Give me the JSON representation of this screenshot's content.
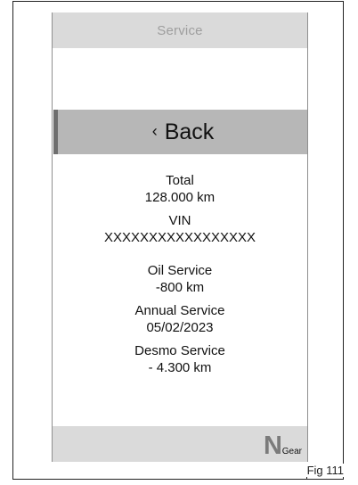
{
  "screen": {
    "header": {
      "title": "Service"
    },
    "back": {
      "icon": "chevron-left-icon",
      "label": "Back"
    },
    "sections": {
      "total": {
        "label": "Total",
        "value": "128.000 km"
      },
      "vin": {
        "label": "VIN",
        "value": "XXXXXXXXXXXXXXXXX"
      },
      "oil_service": {
        "label": "Oil Service",
        "value": "-800 km"
      },
      "annual_service": {
        "label": "Annual Service",
        "value": "05/02/2023"
      },
      "desmo_service": {
        "label": "Desmo Service",
        "value": "- 4.300 km"
      }
    },
    "footer": {
      "gear_value": "N",
      "gear_label": "Gear"
    }
  },
  "figure": {
    "label": "Fig 111"
  },
  "colors": {
    "header_bg": "#dadada",
    "button_bg": "#b7b7b7",
    "button_edge": "#6f6f6f",
    "muted_text": "#9e9e9e",
    "gear_text": "#7b7b7b"
  }
}
